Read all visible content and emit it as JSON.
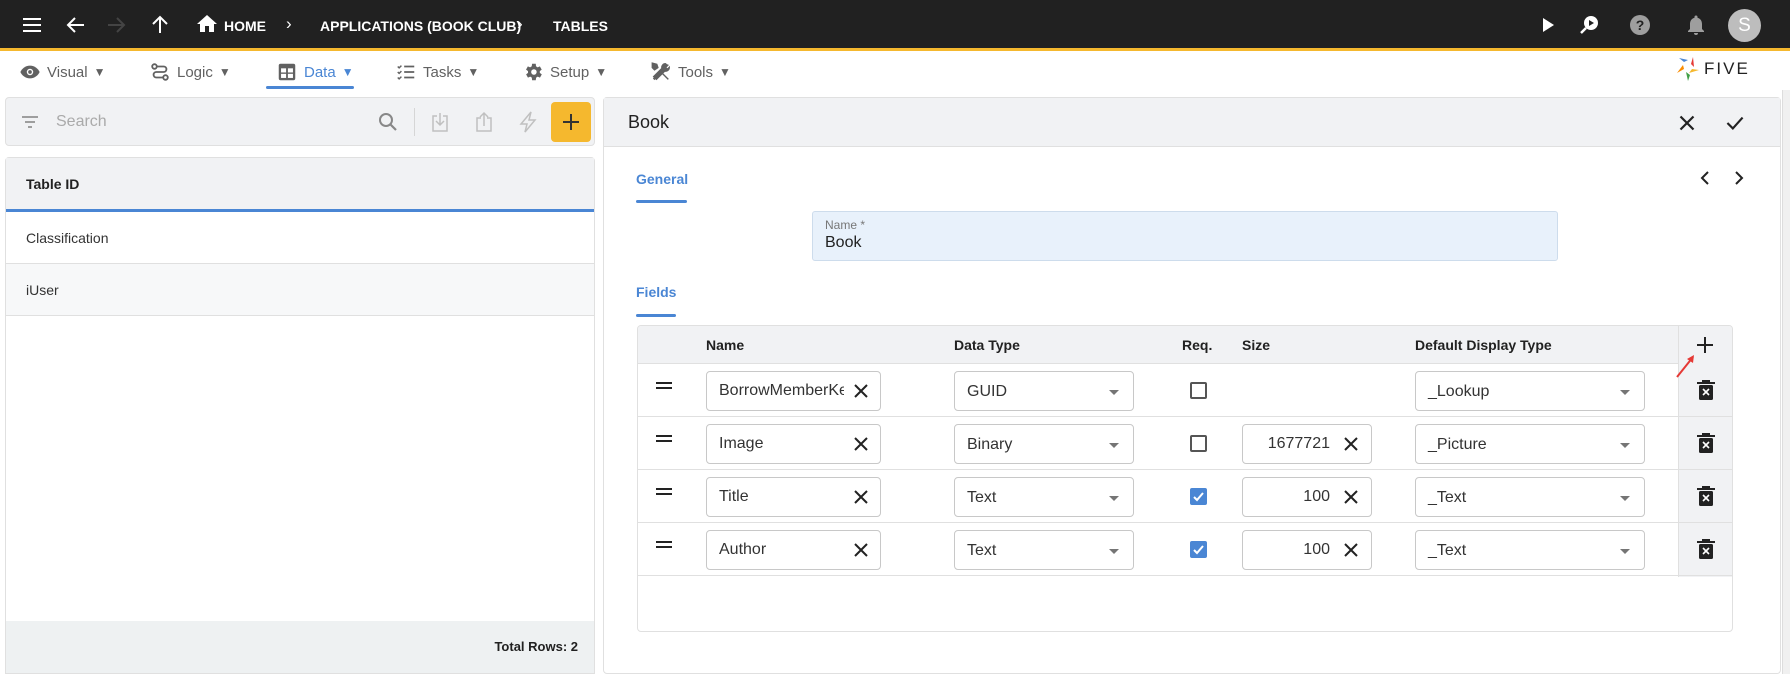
{
  "topbar": {
    "breadcrumbs": [
      "HOME",
      "APPLICATIONS (BOOK CLUB)",
      "TABLES"
    ],
    "avatar_initial": "S"
  },
  "menu": {
    "items": [
      {
        "label": "Visual",
        "icon": "eye-icon"
      },
      {
        "label": "Logic",
        "icon": "logic-icon"
      },
      {
        "label": "Data",
        "icon": "table-icon",
        "active": true
      },
      {
        "label": "Tasks",
        "icon": "checklist-icon"
      },
      {
        "label": "Setup",
        "icon": "gear-icon"
      },
      {
        "label": "Tools",
        "icon": "tools-icon"
      }
    ],
    "caret": "▼",
    "logo_text": "FIVE"
  },
  "left": {
    "search_placeholder": "Search",
    "column_header": "Table ID",
    "rows": [
      "Classification",
      "iUser"
    ],
    "footer": "Total Rows: 2"
  },
  "form": {
    "title": "Book",
    "general_tab": "General",
    "name_label": "Name *",
    "name_value": "Book",
    "fields_tab": "Fields",
    "columns": [
      "Name",
      "Data Type",
      "Req.",
      "Size",
      "Default Display Type"
    ],
    "fields": [
      {
        "name": "BorrowMemberKe",
        "data_type": "GUID",
        "required": false,
        "size": "",
        "display_type": "_Lookup"
      },
      {
        "name": "Image",
        "data_type": "Binary",
        "required": false,
        "size": "1677721",
        "display_type": "_Picture"
      },
      {
        "name": "Title",
        "data_type": "Text",
        "required": true,
        "size": "100",
        "display_type": "_Text"
      },
      {
        "name": "Author",
        "data_type": "Text",
        "required": true,
        "size": "100",
        "display_type": "_Text"
      }
    ]
  },
  "colors": {
    "accent": "#4a86d4",
    "brand_yellow": "#f5b82e",
    "topbar": "#212121"
  }
}
